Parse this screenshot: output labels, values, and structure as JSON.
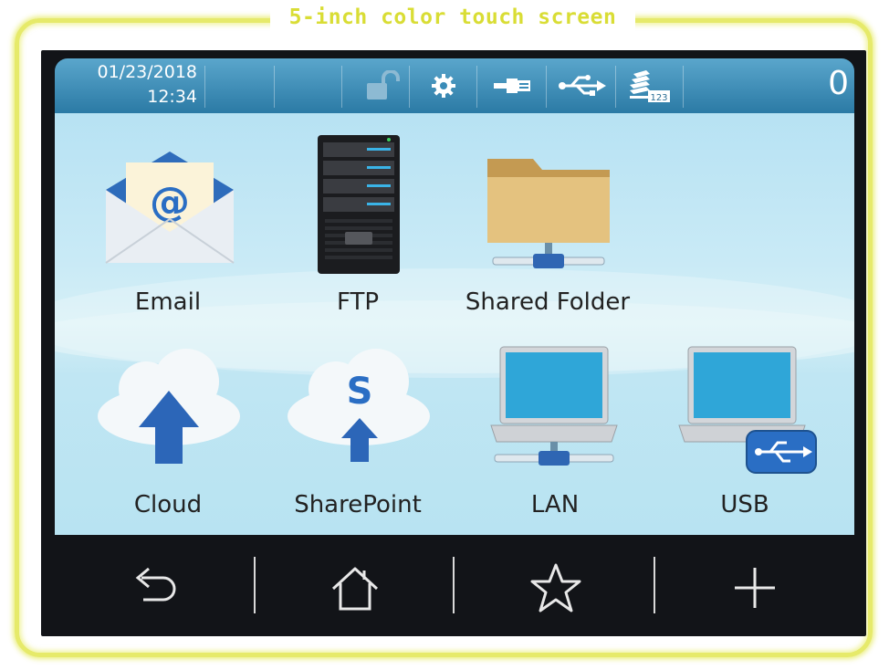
{
  "frame_title": "5-inch color touch screen",
  "status": {
    "date": "01/23/2018",
    "time": "12:34",
    "icons": [
      "lock-open-icon",
      "gear-icon",
      "network-plug-icon",
      "usb-icon",
      "paper-counter-icon"
    ],
    "paper_counter_label": "123",
    "counter": "0"
  },
  "tiles": [
    {
      "label": "Email",
      "icon": "email-icon"
    },
    {
      "label": "FTP",
      "icon": "ftp-server-icon"
    },
    {
      "label": "Shared Folder",
      "icon": "shared-folder-icon"
    },
    {
      "label": "Cloud",
      "icon": "cloud-upload-icon"
    },
    {
      "label": "SharePoint",
      "icon": "sharepoint-icon"
    },
    {
      "label": "LAN",
      "icon": "lan-laptop-icon"
    },
    {
      "label": "USB",
      "icon": "usb-laptop-icon"
    }
  ],
  "email_glyph": "@",
  "sharepoint_glyph": "S",
  "nav": [
    "back-icon",
    "home-icon",
    "star-icon",
    "plus-icon"
  ],
  "colors": {
    "frame": "#e6ea6a",
    "status_bar": "#3a8cb8",
    "content_bg": "#c9eaf6",
    "nav_bg": "#121418",
    "accent_blue": "#2a6ec4"
  }
}
